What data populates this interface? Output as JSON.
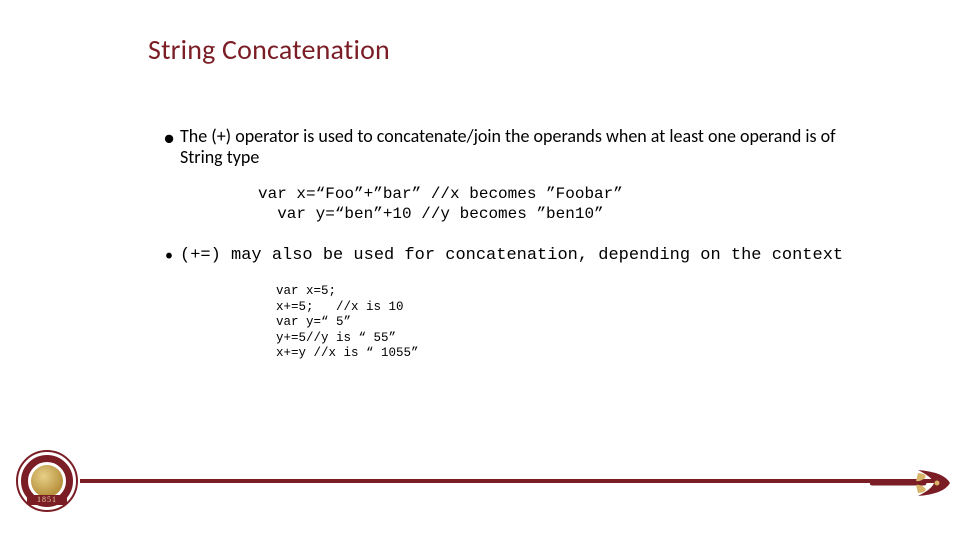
{
  "title": "String Concatenation",
  "bullets": [
    {
      "glyph": "●",
      "style": "sans",
      "text": "The (+) operator is used to concatenate/join the operands when at least one operand is of String type"
    },
    {
      "glyph": "•",
      "style": "mono",
      "text": "(+=) may also be used for concatenation, depending on the context"
    }
  ],
  "code1": "var x=“Foo”+”bar” //x becomes ”Foobar”\n  var y=“ben”+10 //y becomes ”ben10”",
  "code2": "var x=5;\nx+=5;   //x is 10\nvar y=“ 5”\ny+=5//y is “ 55”\nx+=y //x is “ 1055”",
  "seal_year": "1851"
}
